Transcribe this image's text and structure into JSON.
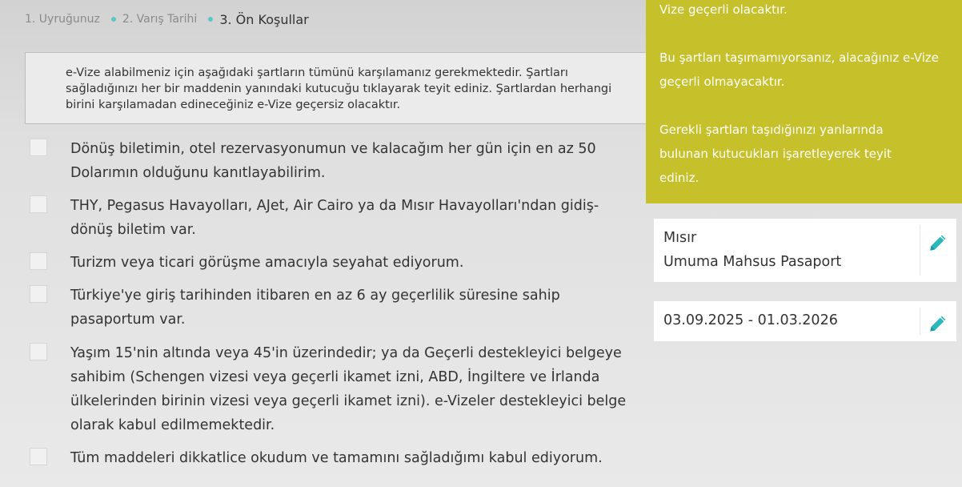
{
  "steps": [
    {
      "label": "1. Uyruğunuz"
    },
    {
      "label": "2. Varış Tarihi"
    },
    {
      "label": "3. Ön Koşullar"
    }
  ],
  "notice": "e-Vize alabilmeniz için aşağıdaki şartların tümünü karşılamanız gerekmektedir. Şartları sağladığınızı her bir maddenin yanındaki kutucuğu tıklayarak teyit ediniz. Şartlardan herhangi birini karşılamadan edineceğiniz e-Vize geçersiz olacaktır.",
  "requirements": [
    {
      "text": "Dönüş biletimin, otel rezervasyonumun ve kalacağım her gün için en az 50 Dolarımın olduğunu kanıtlayabilirim."
    },
    {
      "text": "THY, Pegasus Havayolları, AJet, Air Cairo ya da Mısır Havayolları'ndan gidiş-dönüş biletim var."
    },
    {
      "text": "Turizm veya ticari görüşme amacıyla seyahat ediyorum."
    },
    {
      "text": "Türkiye'ye giriş tarihinden itibaren en az 6 ay geçerlilik süresine sahip pasaportum var."
    },
    {
      "text": "Yaşım 15'nin altında veya 45'in üzerindedir; ya da Geçerli destekleyici belgeye sahibim (Schengen vizesi veya geçerli ikamet izni, ABD, İngiltere ve İrlanda ülkelerinden birinin vizesi veya geçerli ikamet izni). e-Vizeler destekleyici belge olarak kabul edilmemektedir."
    },
    {
      "text": "Tüm maddeleri dikkatlice okudum ve tamamını sağladığımı kabul ediyorum."
    }
  ],
  "help": {
    "p1": "Vize geçerli olacaktır.",
    "p2": "Bu şartları taşımamıyorsanız, alacağınız e-Vize geçerli olmayacaktır.",
    "p3": "Gerekli şartları taşıdığınızı yanlarında bulunan kutucukları işaretleyerek teyit ediniz."
  },
  "summary": {
    "country": "Mısır",
    "passport_type": "Umuma Mahsus Pasaport",
    "dates": "03.09.2025 - 01.03.2026"
  },
  "icons": {
    "edit": "pencil-icon",
    "step_separator": "dot"
  },
  "colors": {
    "accent": "#c6c02a",
    "icon": "#2bb8bc",
    "dot": "#5bc6c8"
  }
}
